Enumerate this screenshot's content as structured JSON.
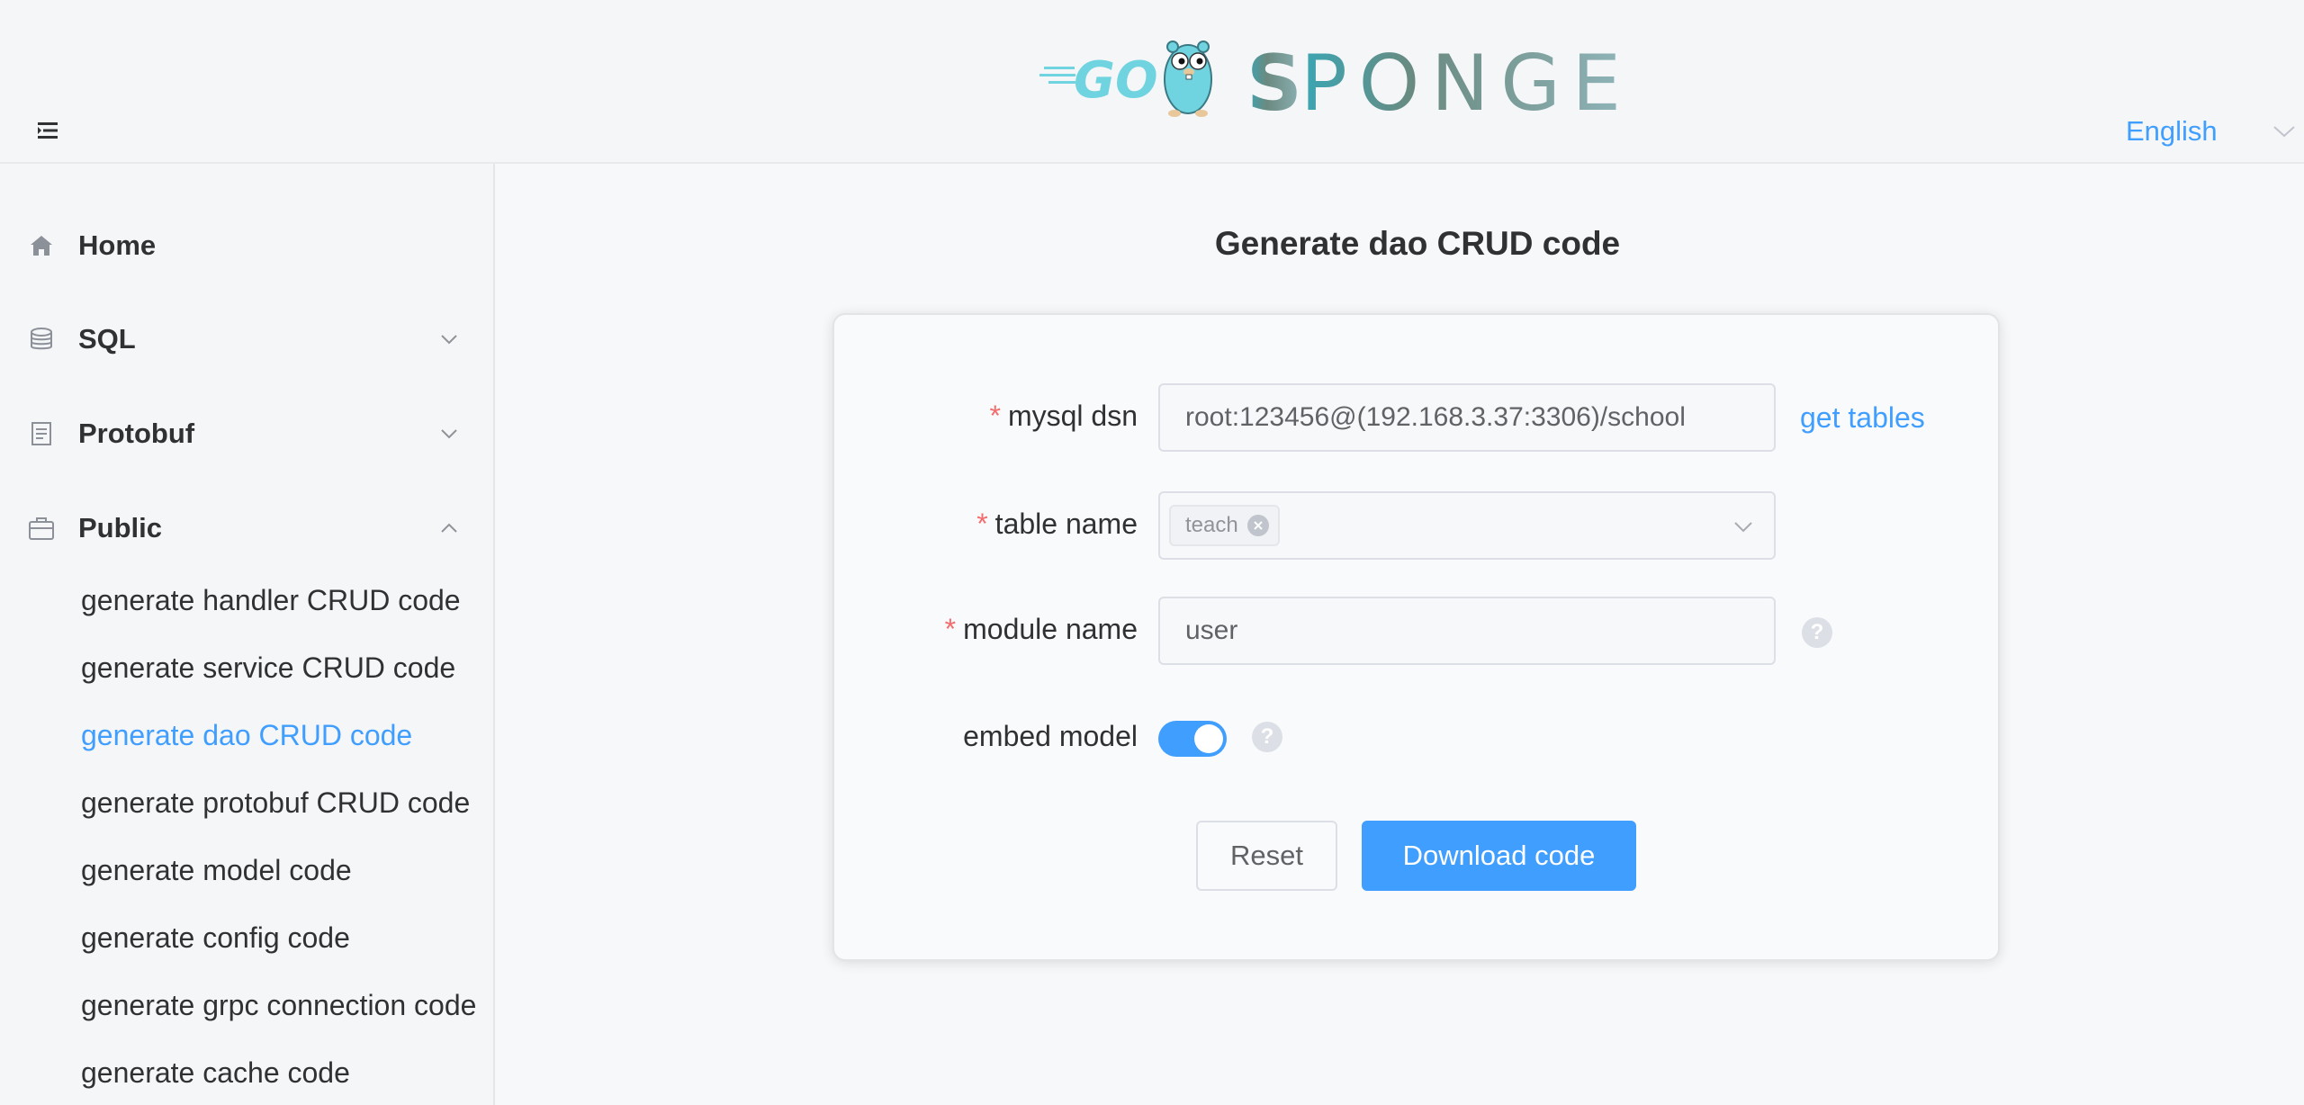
{
  "header": {
    "logo_text": "GO SPONGE",
    "language": "English",
    "menu_toggle_icon": "menu-fold-icon",
    "language_arrow_icon": "chevron-down-icon"
  },
  "sidebar": {
    "items": [
      {
        "label": "Home",
        "icon": "home-icon"
      },
      {
        "label": "SQL",
        "icon": "database-icon",
        "expanded": false
      },
      {
        "label": "Protobuf",
        "icon": "document-icon",
        "expanded": false
      },
      {
        "label": "Public",
        "icon": "briefcase-icon",
        "expanded": true
      }
    ],
    "public_sub_items": [
      {
        "label": "generate handler CRUD code"
      },
      {
        "label": "generate service CRUD code"
      },
      {
        "label": "generate dao CRUD code",
        "active": true
      },
      {
        "label": "generate protobuf CRUD code"
      },
      {
        "label": "generate model code"
      },
      {
        "label": "generate config code"
      },
      {
        "label": "generate grpc connection code"
      },
      {
        "label": "generate cache code"
      }
    ]
  },
  "main": {
    "title": "Generate dao CRUD code",
    "form": {
      "mysql_dsn_label": "mysql dsn",
      "mysql_dsn_value": "root:123456@(192.168.3.37:3306)/school",
      "get_tables_link": "get tables",
      "table_name_label": "table name",
      "table_name_tag": "teach",
      "module_name_label": "module name",
      "module_name_value": "user",
      "embed_model_label": "embed model",
      "embed_model_enabled": true,
      "required_mark": "*",
      "help_mark": "?"
    },
    "buttons": {
      "reset": "Reset",
      "download": "Download code"
    }
  },
  "colors": {
    "accent": "#409eff",
    "required": "#f56c6c",
    "text": "#303133"
  }
}
